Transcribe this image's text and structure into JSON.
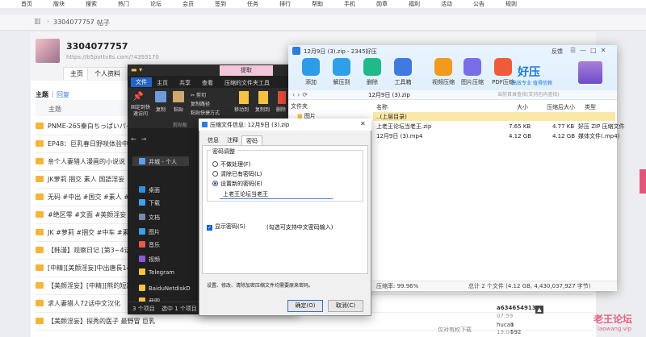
{
  "crumbs": {
    "user_id": "3304077757",
    "section": "帖子"
  },
  "topnav": [
    "首页",
    "版块",
    "搜索",
    "热门",
    "论坛",
    "会员",
    "签到",
    "任务",
    "排行",
    "帮助",
    "手机",
    "勋章",
    "福利",
    "活动",
    "公告",
    "规则"
  ],
  "profile": {
    "name": "3304077757",
    "url": "https://b5pottv8s.com/?4393170",
    "tab_home": "主页",
    "tab_profile": "个人资料"
  },
  "forum": {
    "tab_topics": "主题",
    "tab_replies": "回复",
    "col_topic": "主题",
    "rows": [
      "PNME-265秦白ちっぱいパイ",
      "EP48：巨乳春日野咲体验中",
      "亲个人妻猎人漫画的小说说",
      "JK萝莉 捆交 素人 国語淫妄",
      "无码 #中出 #国交 #素人 #巨乳",
      "#绝区零 #文面 #美颜淫妄",
      "JK #萝莉 #捆交 #中车 #素人",
      "【韩漫】观察日记 [第3~4话]",
      "[中精][美颜淫妄]中出唐長149cm",
      "【美颜淫妄】[中精][熊的短篇",
      "求人妻猎人72话中文汉化",
      "【美颜淫妄】探秀的医子 最野冒 巨乳"
    ],
    "last_user_1": "a634654913",
    "last_time_1": "07:59",
    "last_user_2": "hucan",
    "last_time_2": "19:04",
    "count_2": "592",
    "bottom_count": "1",
    "bottom_note": "仅对有权下载"
  },
  "explorer": {
    "ribbon_title": "提取",
    "tabs": [
      "文件",
      "主页",
      "共享",
      "查看",
      "压缩的文件夹工具"
    ],
    "cmds": [
      "固定到快速访问",
      "复制",
      "粘贴",
      "剪切",
      "复制路径",
      "粘贴快捷方式",
      "移动到",
      "复制到",
      "删除"
    ],
    "group_clip": "剪贴板",
    "nav": [
      "井城 - 个人",
      "桌面",
      "下载",
      "文档",
      "图片",
      "音乐",
      "视频",
      "Telegram",
      "BaiduNetdiskD",
      "截图"
    ],
    "status": "3 个项目",
    "status_sel": "选中 1 个项目"
  },
  "haozip": {
    "title": "12月9日 (3).zip - 2345好压",
    "feedback": "反馈",
    "tools": [
      "添加",
      "解压到",
      "删除",
      "工具箱",
      "视频压缩",
      "图片压缩",
      "PDF压缩"
    ],
    "brand": "好压",
    "brand_sub": "高效专业 值得信赖",
    "path": "12月9日 (3).zip",
    "search_placeholder": "当前目录查找(支持包内查找)",
    "tree_header": "文件夹",
    "tree_item": "图片",
    "cols": {
      "name": "名称",
      "size": "大小",
      "packed": "压缩后大小",
      "type": "类型"
    },
    "files": [
      {
        "name": "..(上层目录)",
        "size": "",
        "packed": "",
        "type": ""
      },
      {
        "name": "上老王论坛当老王.zip",
        "size": "7.65 KB",
        "packed": "4.77 KB",
        "type": "好压 ZIP 压缩文件"
      },
      {
        "name": "12月9日 (3).mp4",
        "size": "4.12 GB",
        "packed": "4.12 GB",
        "type": "媒体文件(.mp4)"
      }
    ],
    "status_left": "压缩率: 99.96%",
    "status_right": "总计 2 个文件 (4.12 GB, 4,430,037,927 字节)"
  },
  "dialog": {
    "title": "压缩文件信息: 12月9日 (3).zip",
    "tabs": [
      "信息",
      "注释",
      "密码"
    ],
    "group": "密码调整",
    "opt1": "不做处理(F)",
    "opt2": "清除已有密码(L)",
    "opt3": "设置新的密码(E)",
    "password": "上老王论坛当老王",
    "show_pwd": "显示密码(S)",
    "show_pwd_hint": "(勾选可支持中文密码输入)",
    "note": "设置、修改、清除加密压缩文件均需要原来密码。",
    "ok": "确定(O)",
    "cancel": "取消(C)"
  },
  "watermark": {
    "main": "老王论坛",
    "sub": "laowang.vip"
  }
}
